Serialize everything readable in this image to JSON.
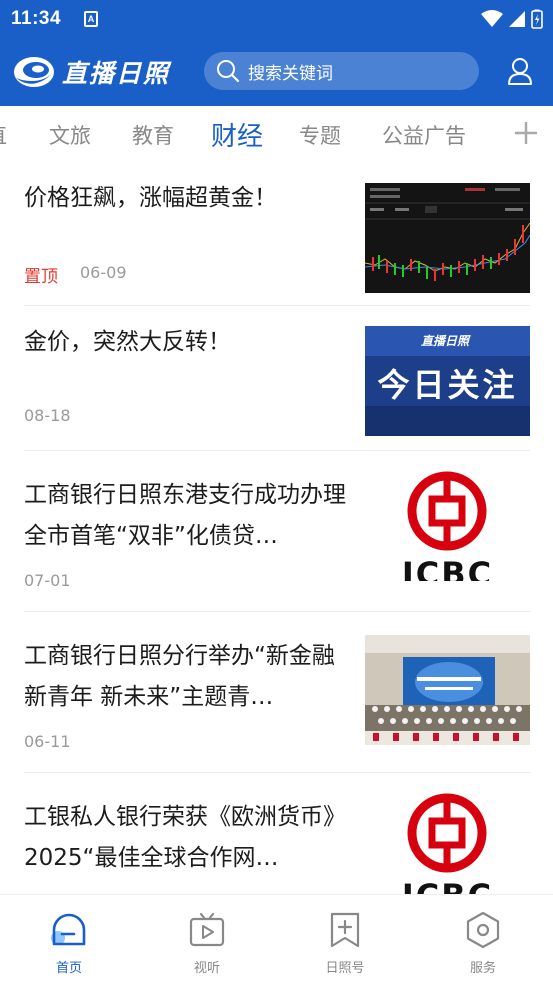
{
  "status_bar": {
    "time": "11:34",
    "app_icon_letter": "A"
  },
  "header": {
    "logo_text": "直播日照",
    "search_placeholder": "搜索关键词"
  },
  "tabs": {
    "items": [
      {
        "label": "直"
      },
      {
        "label": "文旅"
      },
      {
        "label": "教育"
      },
      {
        "label": "财经",
        "active": true
      },
      {
        "label": "专题"
      },
      {
        "label": "公益广告"
      }
    ]
  },
  "news": [
    {
      "title": "价格狂飙，涨幅超黄金！",
      "top_label": "置顶",
      "date": "06-09",
      "thumb": "stock-chart"
    },
    {
      "title": "金价，突然大反转！",
      "date": "08-18",
      "thumb": "today-focus",
      "thumb_logo": "直播日照",
      "thumb_text": "今日关注"
    },
    {
      "title": "工商银行日照东港支行成功办理全市首笔“双非”化债贷…",
      "date": "07-01",
      "thumb": "icbc-logo",
      "thumb_text": "ICBC"
    },
    {
      "title": "工商银行日照分行举办“新金融 新青年 新未来”主题青…",
      "date": "06-11",
      "thumb": "group-photo"
    },
    {
      "title": "工银私人银行荣获《欧洲货币》2025“最佳全球合作网…",
      "thumb": "icbc-logo",
      "thumb_text": "ICBC"
    }
  ],
  "bottom_nav": [
    {
      "label": "首页",
      "icon": "home-icon",
      "active": true
    },
    {
      "label": "视听",
      "icon": "tv-icon"
    },
    {
      "label": "日照号",
      "icon": "bookmark-plus-icon"
    },
    {
      "label": "服务",
      "icon": "hexagon-icon"
    }
  ],
  "colors": {
    "brand": "#1a5fc8",
    "top_label": "#e23b2e",
    "icbc_red": "#d7000f"
  }
}
